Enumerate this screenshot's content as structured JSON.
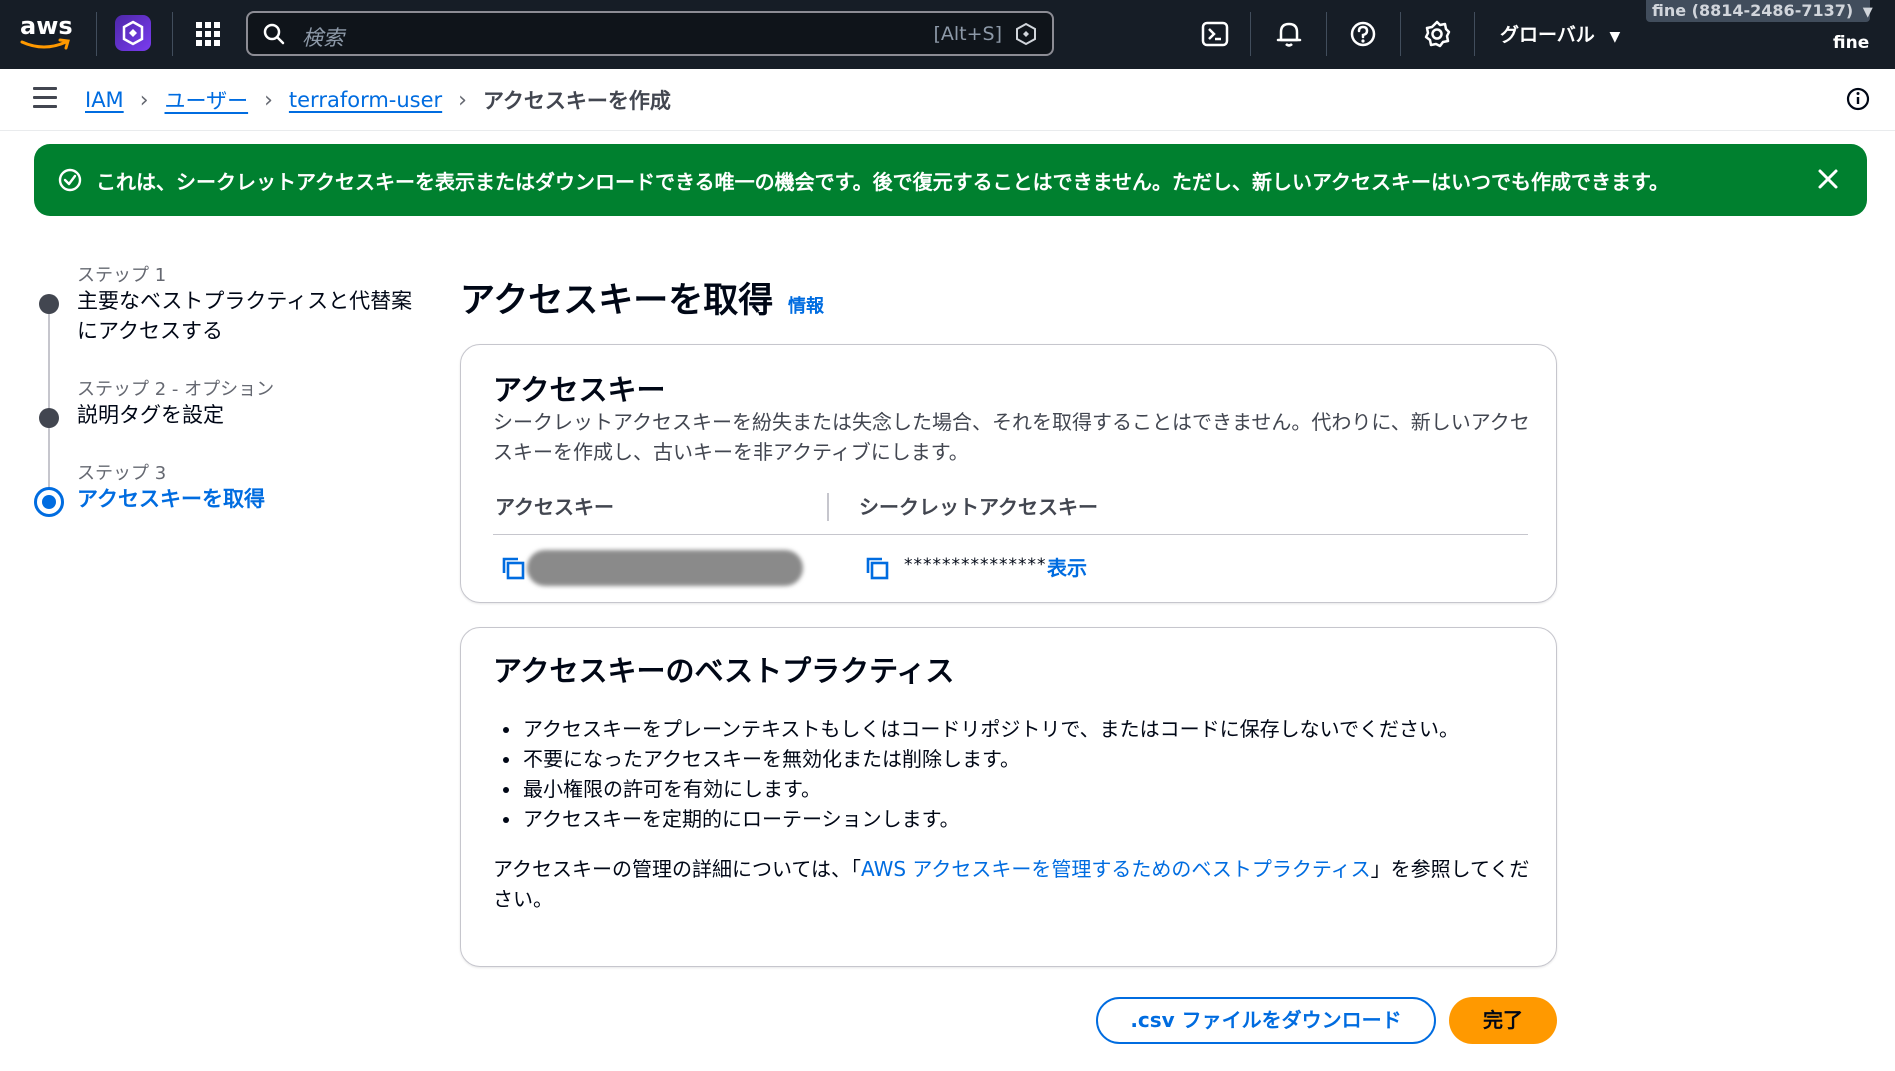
{
  "topnav": {
    "logo_text": "aws",
    "search_placeholder": "検索",
    "search_shortcut": "[Alt+S]",
    "region_label": "グローバル",
    "account_label": "fine (8814-2486-7137)",
    "user_label": "fine"
  },
  "breadcrumb": {
    "items": [
      "IAM",
      "ユーザー",
      "terraform-user"
    ],
    "current": "アクセスキーを作成"
  },
  "flash": {
    "message": "これは、シークレットアクセスキーを表示またはダウンロードできる唯一の機会です。後で復元することはできません。ただし、新しいアクセスキーはいつでも作成できます。"
  },
  "steps": [
    {
      "num": "ステップ 1",
      "title_line1": "主要なベストプラクティスと代替案",
      "title_line2": "にアクセスする"
    },
    {
      "num": "ステップ 2 - オプション",
      "title_line1": "説明タグを設定"
    },
    {
      "num": "ステップ 3",
      "title_line1": "アクセスキーを取得"
    }
  ],
  "main": {
    "title": "アクセスキーを取得",
    "info_link": "情報"
  },
  "access_key_card": {
    "heading": "アクセスキー",
    "description": "シークレットアクセスキーを紛失または失念した場合、それを取得することはできません。代わりに、新しいアクセスキーを作成し、古いキーを非アクティブにします。",
    "col_access_key": "アクセスキー",
    "col_secret_key": "シークレットアクセスキー",
    "secret_masked": "***************",
    "show_label": "表示"
  },
  "best_practices_card": {
    "heading": "アクセスキーのベストプラクティス",
    "items": [
      "アクセスキーをプレーンテキストもしくはコードリポジトリで、またはコードに保存しないでください。",
      "不要になったアクセスキーを無効化または削除します。",
      "最小権限の許可を有効にします。",
      "アクセスキーを定期的にローテーションします。"
    ],
    "note_prefix": "アクセスキーの管理の詳細については、「",
    "note_link": "AWS アクセスキーを管理するためのベストプラクティス",
    "note_suffix": "」を参照してください。"
  },
  "buttons": {
    "download_csv": ".csv ファイルをダウンロード",
    "done": "完了"
  },
  "colors": {
    "nav_bg": "#161d26",
    "flash_bg": "#00802f",
    "link": "#006ce0",
    "primary_button": "#ff9900"
  }
}
